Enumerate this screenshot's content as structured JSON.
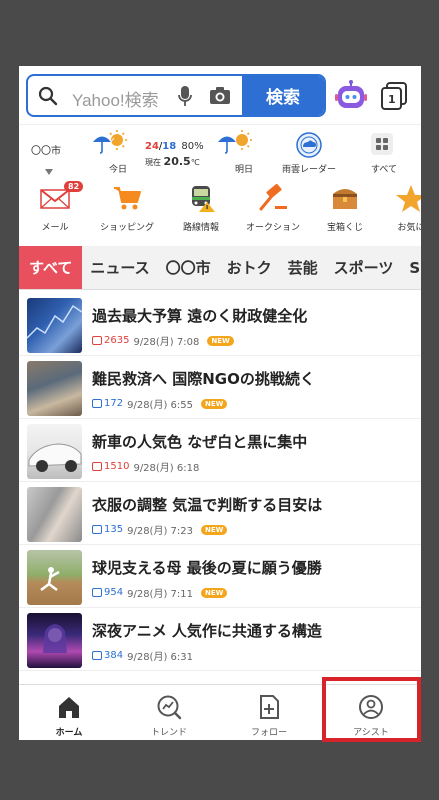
{
  "search": {
    "placeholder": "Yahoo!検索",
    "button_label": "検索"
  },
  "tabs_count": "1",
  "weather": {
    "city": "〇〇市",
    "today_label": "今日",
    "temp_high": "24",
    "temp_low": "18",
    "precip": "80%",
    "now_prefix": "現在",
    "now_temp": "20.5",
    "now_unit": "℃",
    "tomorrow_label": "明日",
    "radar_label": "雨雲レーダー",
    "all_label": "すべて"
  },
  "services": [
    {
      "label": "メール",
      "icon": "mail-icon",
      "badge": "82"
    },
    {
      "label": "ショッピング",
      "icon": "cart-icon"
    },
    {
      "label": "路線情報",
      "icon": "train-icon"
    },
    {
      "label": "オークション",
      "icon": "auction-icon"
    },
    {
      "label": "宝箱くじ",
      "icon": "treasure-icon"
    },
    {
      "label": "お気に",
      "icon": "star-icon"
    }
  ],
  "categories": [
    "すべて",
    "ニュース",
    "〇〇市",
    "おトク",
    "芸能",
    "スポーツ",
    "S"
  ],
  "news": [
    {
      "title": "過去最大予算 遠のく財政健全化",
      "comments": "2635",
      "hot": true,
      "time": "9/28(月) 7:08",
      "new": "NEW"
    },
    {
      "title": "難民救済へ 国際NGOの挑戦続く",
      "comments": "172",
      "hot": false,
      "time": "9/28(月) 6:55",
      "new": "NEW"
    },
    {
      "title": "新車の人気色 なぜ白と黒に集中",
      "comments": "1510",
      "hot": true,
      "time": "9/28(月) 6:18",
      "new": ""
    },
    {
      "title": "衣服の調整 気温で判断する目安は",
      "comments": "135",
      "hot": false,
      "time": "9/28(月) 7:23",
      "new": "NEW"
    },
    {
      "title": "球児支える母 最後の夏に願う優勝",
      "comments": "954",
      "hot": false,
      "time": "9/28(月) 7:11",
      "new": "NEW"
    },
    {
      "title": "深夜アニメ 人気作に共通する構造",
      "comments": "384",
      "hot": false,
      "time": "9/28(月) 6:31",
      "new": ""
    }
  ],
  "bottom_nav": [
    {
      "label": "ホーム",
      "icon": "home-icon"
    },
    {
      "label": "トレンド",
      "icon": "trend-icon"
    },
    {
      "label": "フォロー",
      "icon": "follow-icon"
    },
    {
      "label": "アシスト",
      "icon": "assist-icon"
    }
  ],
  "colors": {
    "brand_blue": "#2d6fd3",
    "accent_red": "#e8505e",
    "highlight": "#d8232a"
  }
}
